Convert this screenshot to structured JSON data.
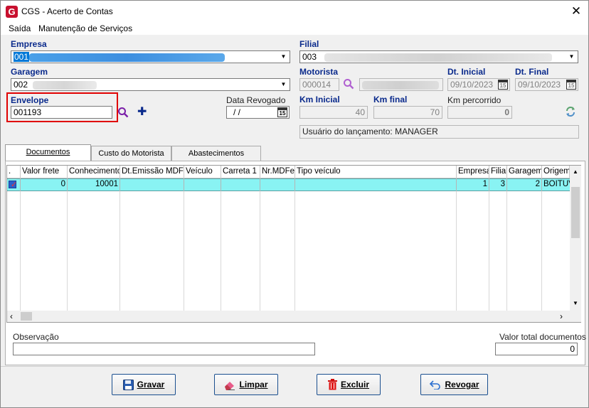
{
  "window": {
    "title": "CGS - Acerto de Contas",
    "logo_letter": "G",
    "close_glyph": "✕"
  },
  "menu": {
    "items": [
      "Saída",
      "Manutenção de Serviços"
    ]
  },
  "colors": {
    "label_blue": "#0a2a8c",
    "selection_blue": "#0078d7",
    "row_cyan": "#89f3f3",
    "envelope_highlight": "#e00000"
  },
  "form": {
    "empresa": {
      "label": "Empresa",
      "value": "001"
    },
    "filial": {
      "label": "Filial",
      "value": "003"
    },
    "garagem": {
      "label": "Garagem",
      "value": "002"
    },
    "motorista": {
      "label": "Motorista",
      "code": "000014"
    },
    "dt_inicial": {
      "label": "Dt. Inicial",
      "value": "09/10/2023"
    },
    "dt_final": {
      "label": "Dt. Final",
      "value": "09/10/2023"
    },
    "envelope": {
      "label": "Envelope",
      "value": "001193"
    },
    "data_revogado": {
      "label": "Data Revogado",
      "value": " / /"
    },
    "km_inicial": {
      "label": "Km Inicial",
      "value": "40"
    },
    "km_final": {
      "label": "Km final",
      "value": "70"
    },
    "km_percorrido": {
      "label": "Km percorrido",
      "value": "0"
    },
    "usuario": {
      "text": "Usuário do lançamento: MANAGER"
    },
    "calendar_glyph": "15"
  },
  "tabs": [
    {
      "label": "Documentos",
      "active": true
    },
    {
      "label": "Custo do Motorista",
      "active": false
    },
    {
      "label": "Abastecimentos",
      "active": false
    }
  ],
  "grid": {
    "columns": [
      ".",
      "Valor frete",
      "Conhecimento",
      "Dt.Emissão MDFe",
      "Veículo",
      "Carreta 1",
      "Nr.MDFe",
      "Tipo veículo",
      "Empresa",
      "Filial",
      "Garagem",
      "Origem"
    ],
    "rows": [
      {
        "checked": true,
        "valor_frete": "0",
        "conhecimento": "10001",
        "dt_emissao": "",
        "veiculo": "",
        "carreta": "",
        "nr_mdfe": "",
        "tipo_veiculo": "",
        "empresa": "1",
        "filial": "3",
        "garagem": "2",
        "origem": "BOITUVA"
      }
    ]
  },
  "footer": {
    "observacao_label": "Observação",
    "observacao_value": "",
    "valor_total_label": "Valor total documentos",
    "valor_total_value": "0"
  },
  "buttons": {
    "gravar": {
      "label": "Gravar",
      "icon": "floppy-disk-icon"
    },
    "limpar": {
      "label": "Limpar",
      "icon": "eraser-icon"
    },
    "excluir": {
      "label": "Excluir",
      "icon": "trash-icon"
    },
    "revogar": {
      "label": "Revogar",
      "icon": "undo-arrow-icon"
    }
  }
}
